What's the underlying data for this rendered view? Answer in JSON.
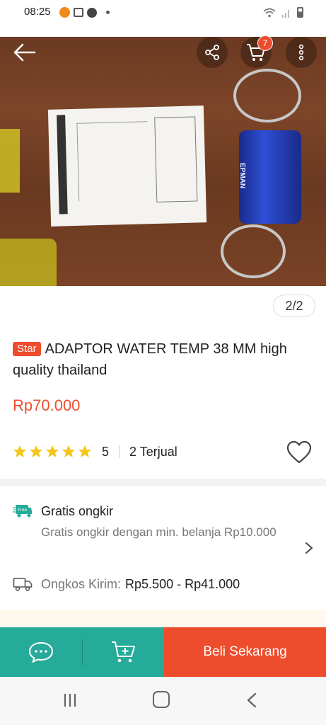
{
  "status_bar": {
    "time": "08:25",
    "icons": [
      "whatsapp-icon",
      "gallery-icon",
      "facebook-icon",
      "dot-icon",
      "wifi-icon",
      "signal-icon",
      "battery-icon"
    ]
  },
  "header": {
    "cart_badge": "7",
    "icons": [
      "back-arrow-icon",
      "share-icon",
      "cart-icon",
      "more-vertical-icon"
    ]
  },
  "gallery": {
    "page_indicator": "2/2",
    "adapter_label": "EPMAN",
    "current_page": 2,
    "total_pages": 2
  },
  "product": {
    "badge": "Star",
    "title": "ADAPTOR WATER TEMP 38 MM high quality thailand",
    "price": "Rp70.000",
    "rating": "5",
    "rating_stars": 5,
    "sold": "2 Terjual"
  },
  "shipping": {
    "free_title": "Gratis ongkir",
    "free_desc": "Gratis ongkir dengan min. belanja Rp10.000",
    "cost_label": "Ongkos Kirim:",
    "cost_value": "Rp5.500 - Rp41.000"
  },
  "bottom_bar": {
    "buy_label": "Beli Sekarang"
  },
  "colors": {
    "brand_orange": "#ee4d2d",
    "teal": "#26aa99"
  }
}
